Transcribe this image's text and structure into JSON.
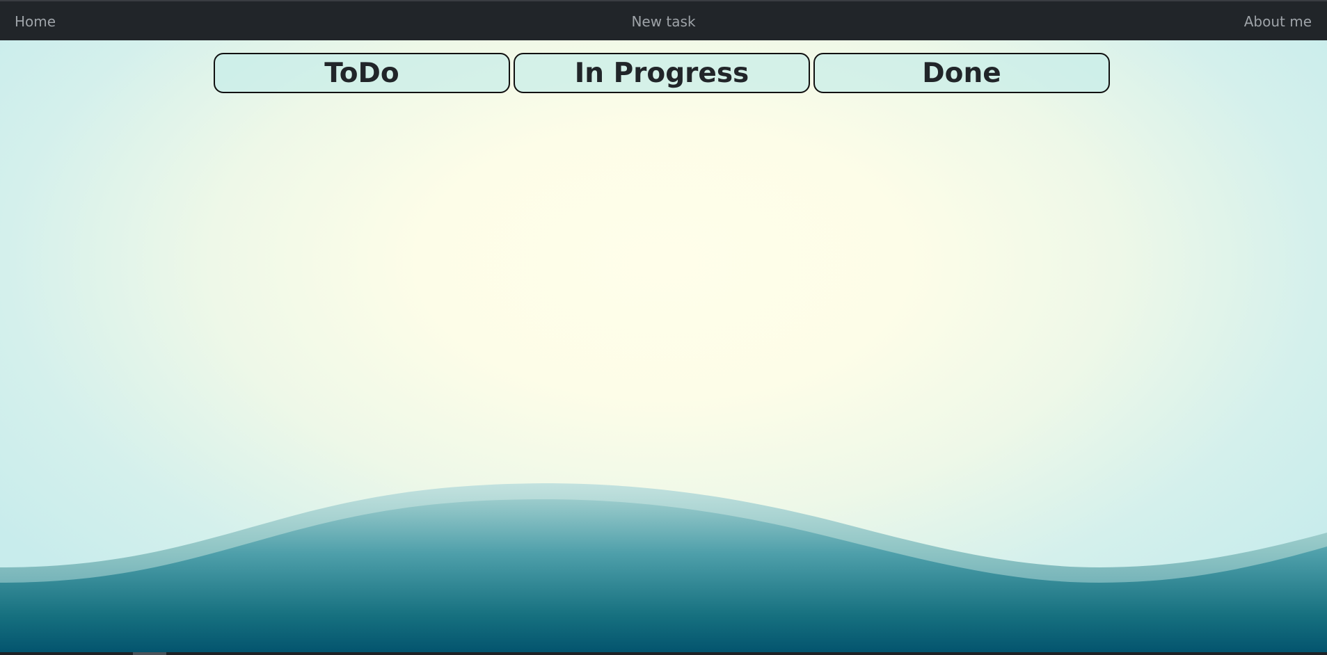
{
  "navbar": {
    "home_label": "Home",
    "new_task_label": "New task",
    "about_label": "About me"
  },
  "board": {
    "columns": [
      {
        "title": "ToDo"
      },
      {
        "title": "In Progress"
      },
      {
        "title": "Done"
      }
    ]
  },
  "colors": {
    "navbar_bg": "#212529",
    "nav_text": "#9ea3a8",
    "background_center": "#fffeea",
    "background_edge": "#c8ecec",
    "wave_light": "#a7d3d3",
    "wave_dark": "#03556f"
  }
}
